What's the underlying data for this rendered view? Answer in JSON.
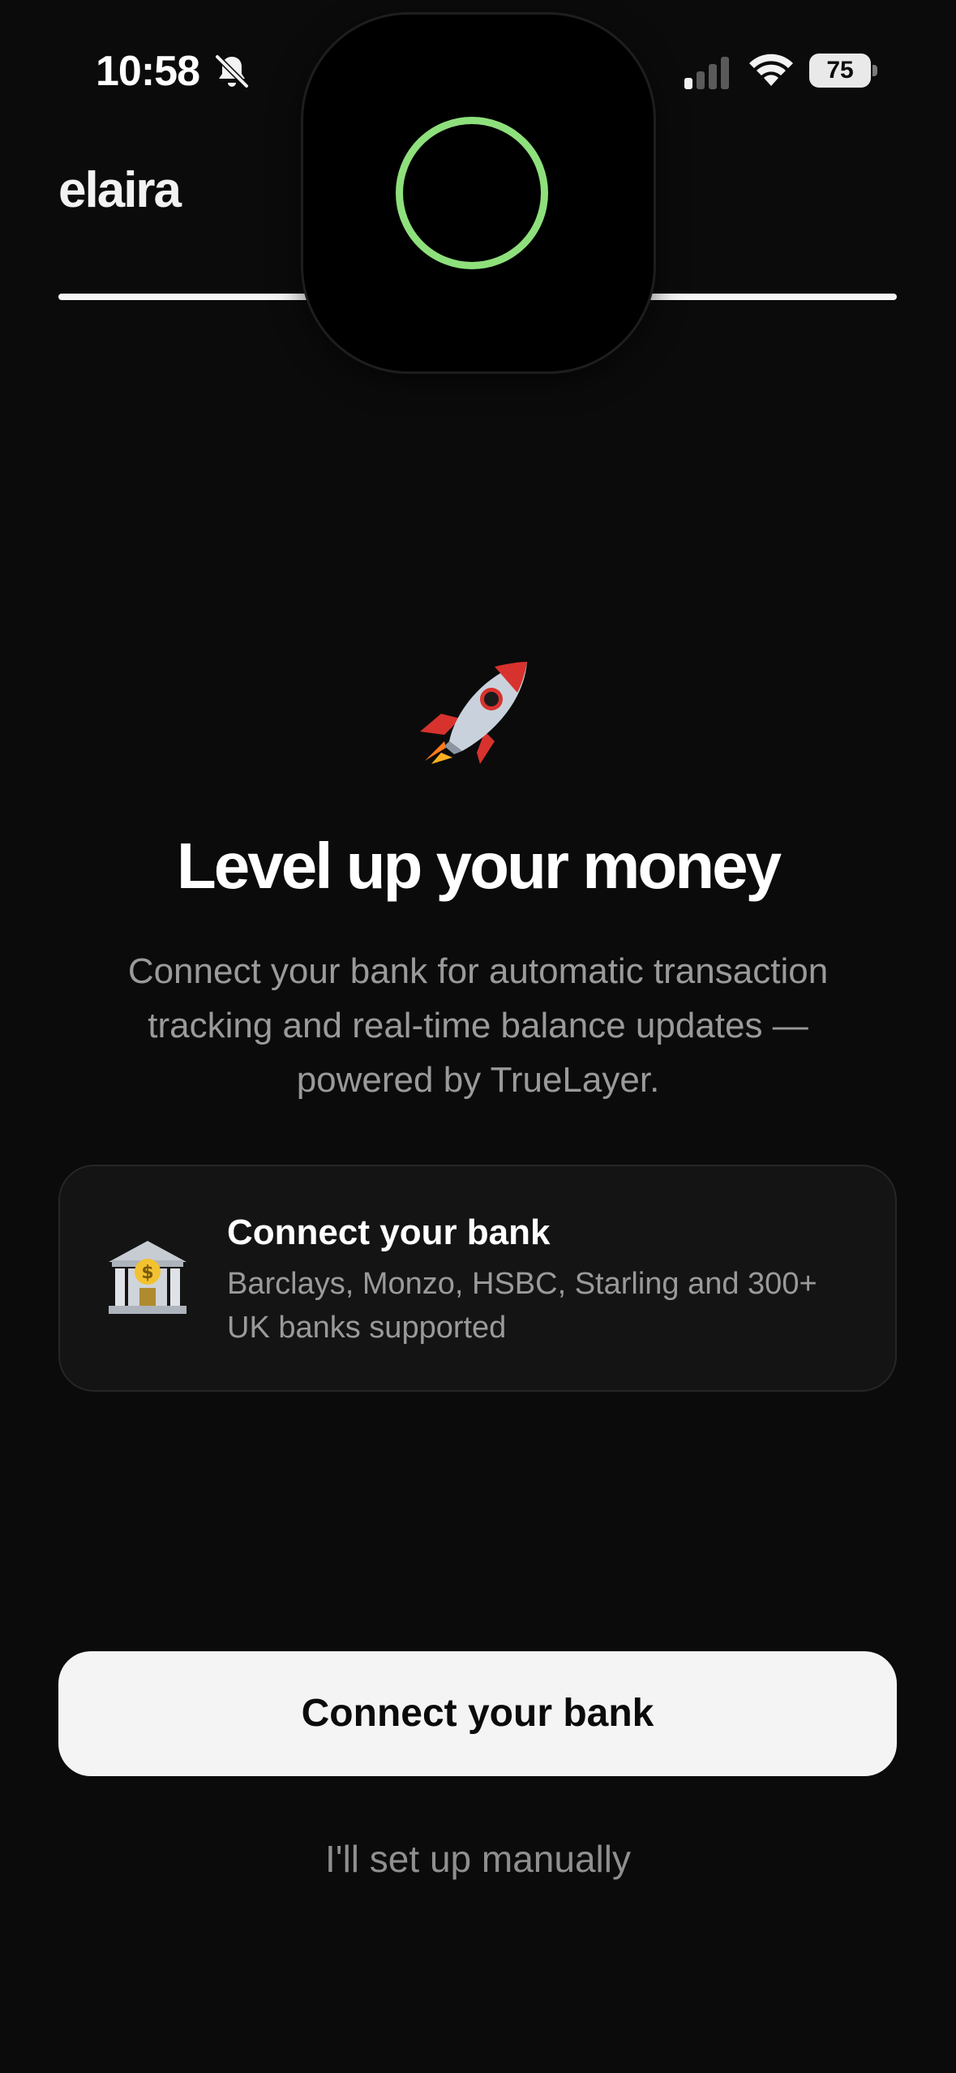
{
  "status_bar": {
    "time": "10:58",
    "battery_percent": "75",
    "silent_mode": true,
    "signal_bars_active": 1,
    "icons": [
      "bell-slash-icon",
      "cellular-signal-icon",
      "wifi-icon",
      "battery-icon"
    ]
  },
  "island": {
    "indicator": "progress-ring",
    "ring_color": "#8ee07c"
  },
  "header": {
    "brand": "elaira",
    "progress_fraction": 1.0
  },
  "hero": {
    "emoji": "rocket-icon",
    "title": "Level up your money",
    "subtitle": "Connect your bank for automatic transaction tracking and real-time balance updates — powered by TrueLayer."
  },
  "card": {
    "icon": "bank-icon",
    "title": "Connect your bank",
    "description": "Barclays, Monzo, HSBC, Starling and 300+ UK banks supported"
  },
  "actions": {
    "primary_label": "Connect your bank",
    "secondary_label": "I'll set up manually"
  },
  "colors": {
    "background": "#0b0b0b",
    "card_background": "#141414",
    "primary_button_background": "#f4f4f4",
    "accent_green": "#8ee07c",
    "muted_text": "#9a9a9a"
  }
}
